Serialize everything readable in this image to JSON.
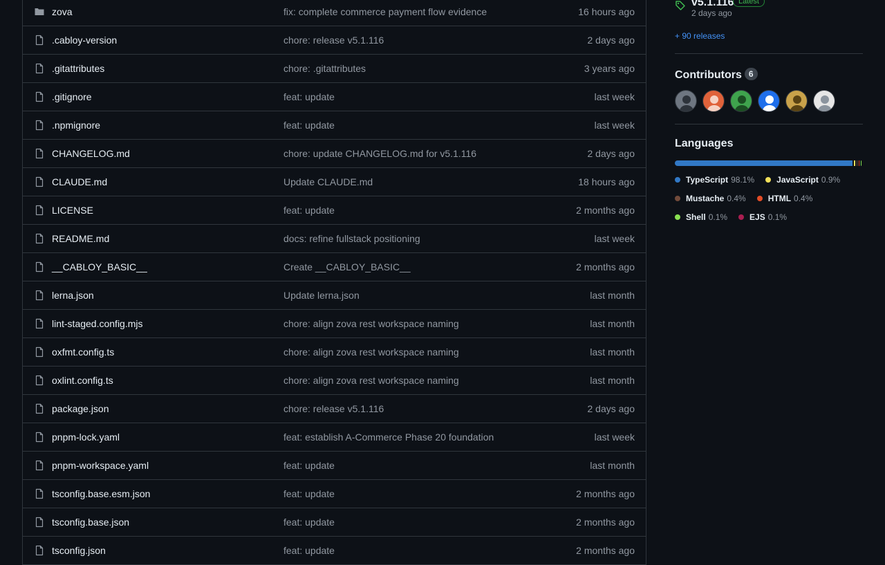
{
  "files": [
    {
      "type": "folder",
      "name": "zova",
      "message": "fix: complete commerce payment flow evidence",
      "time": "16 hours ago"
    },
    {
      "type": "file",
      "name": ".cabloy-version",
      "message": "chore: release v5.1.116",
      "time": "2 days ago"
    },
    {
      "type": "file",
      "name": ".gitattributes",
      "message": "chore: .gitattributes",
      "time": "3 years ago"
    },
    {
      "type": "file",
      "name": ".gitignore",
      "message": "feat: update",
      "time": "last week"
    },
    {
      "type": "file",
      "name": ".npmignore",
      "message": "feat: update",
      "time": "last week"
    },
    {
      "type": "file",
      "name": "CHANGELOG.md",
      "message": "chore: update CHANGELOG.md for v5.1.116",
      "time": "2 days ago"
    },
    {
      "type": "file",
      "name": "CLAUDE.md",
      "message": "Update CLAUDE.md",
      "time": "18 hours ago"
    },
    {
      "type": "file",
      "name": "LICENSE",
      "message": "feat: update",
      "time": "2 months ago"
    },
    {
      "type": "file",
      "name": "README.md",
      "message": "docs: refine fullstack positioning",
      "time": "last week"
    },
    {
      "type": "file",
      "name": "__CABLOY_BASIC__",
      "message": "Create __CABLOY_BASIC__",
      "time": "2 months ago"
    },
    {
      "type": "file",
      "name": "lerna.json",
      "message": "Update lerna.json",
      "time": "last month"
    },
    {
      "type": "file",
      "name": "lint-staged.config.mjs",
      "message": "chore: align zova rest workspace naming",
      "time": "last month"
    },
    {
      "type": "file",
      "name": "oxfmt.config.ts",
      "message": "chore: align zova rest workspace naming",
      "time": "last month"
    },
    {
      "type": "file",
      "name": "oxlint.config.ts",
      "message": "chore: align zova rest workspace naming",
      "time": "last month"
    },
    {
      "type": "file",
      "name": "package.json",
      "message": "chore: release v5.1.116",
      "time": "2 days ago"
    },
    {
      "type": "file",
      "name": "pnpm-lock.yaml",
      "message": "feat: establish A-Commerce Phase 20 foundation",
      "time": "last week"
    },
    {
      "type": "file",
      "name": "pnpm-workspace.yaml",
      "message": "feat: update",
      "time": "last month"
    },
    {
      "type": "file",
      "name": "tsconfig.base.esm.json",
      "message": "feat: update",
      "time": "2 months ago"
    },
    {
      "type": "file",
      "name": "tsconfig.base.json",
      "message": "feat: update",
      "time": "2 months ago"
    },
    {
      "type": "file",
      "name": "tsconfig.json",
      "message": "feat: update",
      "time": "2 months ago"
    }
  ],
  "release": {
    "name": "v5.1.116",
    "badge": "Latest",
    "date": "2 days ago",
    "more": "+ 90 releases"
  },
  "contributors": {
    "title": "Contributors",
    "count": "6",
    "avatars": [
      {
        "name": "avatar-1",
        "bg": "#6e7681",
        "fg": "#2d333b"
      },
      {
        "name": "avatar-2",
        "bg": "#e0623a",
        "fg": "#f6d2c4"
      },
      {
        "name": "avatar-3",
        "bg": "#3fa34d",
        "fg": "#1b4d22"
      },
      {
        "name": "avatar-4",
        "bg": "#1f6feb",
        "fg": "#ffffff"
      },
      {
        "name": "avatar-5",
        "bg": "#c9a24a",
        "fg": "#5a4313"
      },
      {
        "name": "avatar-6",
        "bg": "#e6e6e6",
        "fg": "#8b949e"
      }
    ]
  },
  "languages": {
    "title": "Languages",
    "items": [
      {
        "name": "TypeScript",
        "percent": "98.1%",
        "value": 98.1,
        "color": "#3178c6"
      },
      {
        "name": "JavaScript",
        "percent": "0.9%",
        "value": 0.9,
        "color": "#f1e05a"
      },
      {
        "name": "Mustache",
        "percent": "0.4%",
        "value": 0.4,
        "color": "#724b3b"
      },
      {
        "name": "HTML",
        "percent": "0.4%",
        "value": 0.4,
        "color": "#e34c26"
      },
      {
        "name": "Shell",
        "percent": "0.1%",
        "value": 0.1,
        "color": "#89e051"
      },
      {
        "name": "EJS",
        "percent": "0.1%",
        "value": 0.1,
        "color": "#a91e50"
      }
    ]
  }
}
